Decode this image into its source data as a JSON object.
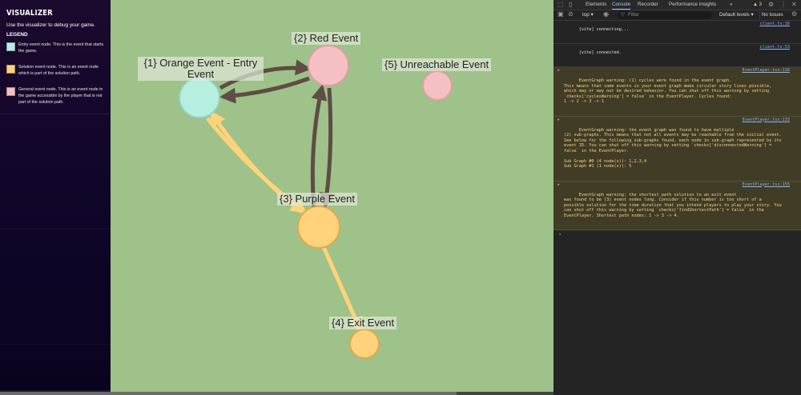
{
  "sidebar": {
    "title": "VISUALIZER",
    "intro": "Use the visualizer to debug your game.",
    "legend_title": "LEGEND",
    "legend": [
      {
        "color": "#b6efe0",
        "text": "Entry event node. This is the event that starts the game."
      },
      {
        "color": "#ffd27c",
        "text": "Solution event node. This is an event node which is part of the solution path."
      },
      {
        "color": "#f4c0c4",
        "text": "General event node. This is an event node in the game accessible by the player that is not part of the solution path."
      }
    ]
  },
  "graph": {
    "colors": {
      "entry": "#b6efe0",
      "solution": "#ffd27c",
      "general": "#f4c0c4",
      "cycle_edge": "#5e4c45",
      "solution_edge": "#ffd37a",
      "background": "#9ec289"
    },
    "nodes": [
      {
        "id": 1,
        "type": "entry",
        "label": "{1} Orange Event - Entry Event"
      },
      {
        "id": 2,
        "type": "general",
        "label": "{2} Red Event"
      },
      {
        "id": 3,
        "type": "solution",
        "label": "{3} Purple Event"
      },
      {
        "id": 4,
        "type": "solution",
        "label": "{4} Exit Event"
      },
      {
        "id": 5,
        "type": "general",
        "label": "{5} Unreachable Event"
      }
    ]
  },
  "devtools": {
    "tabs": [
      "Elements",
      "Console",
      "Recorder",
      "Performance insights"
    ],
    "active_tab": "Console",
    "more_tabs": "»",
    "warning_count": "3",
    "context": "top",
    "filter_placeholder": "Filter",
    "levels": "Default levels ▾",
    "issues": "No Issues",
    "messages": [
      {
        "type": "log",
        "text": "[vite] connecting...",
        "src": "client.ts:16"
      },
      {
        "type": "log",
        "text": "[vite] connected.",
        "src": "client.ts:53"
      },
      {
        "type": "warn",
        "text": "EventGraph warning: (1) cycles were found in the event graph.\nThis means that some events in your event graph make circular story lines possible,\nwhich may or may not be desired behavior. You can shut off this warning by setting\n`checks['cyclesWarning'] = false` in the EventPlayer. Cycles found:\n1 -> 2 -> 3 -> 1",
        "src": "EventPlayer.tsx:116"
      },
      {
        "type": "warn",
        "text": "EventGraph warning: the event graph was found to have multiple\n(2) sub-graphs. This means that not all events may be reachable from the initial event.\nSee below for the following sub-graphs found, each node in sub-graph represented by its\nevent ID. You can shut off this warning by setting `checks['disconnectedWarning'] =\nfalse` in the EventPlayer.\n\nSub Graph #0 (4 node(s)): 1,2,3,4\nSub Graph #1 (1 node(s)): 5",
        "src": "EventPlayer.tsx:133"
      },
      {
        "type": "warn",
        "text": "EventGraph warning: the shortest path solution to an exit event\nwas found to be (3) event nodes long. Consider if this number is too short of a\npossible solution for the time duration that you intend players to play your story. You\ncan shut off this warning by setting `checks['findShortestPath'] = false` in the\nEventPlayer. Shortest path nodes: 1 -> 3 -> 4.",
        "src": "EventPlayer.tsx:155"
      }
    ],
    "prompt": "›"
  }
}
